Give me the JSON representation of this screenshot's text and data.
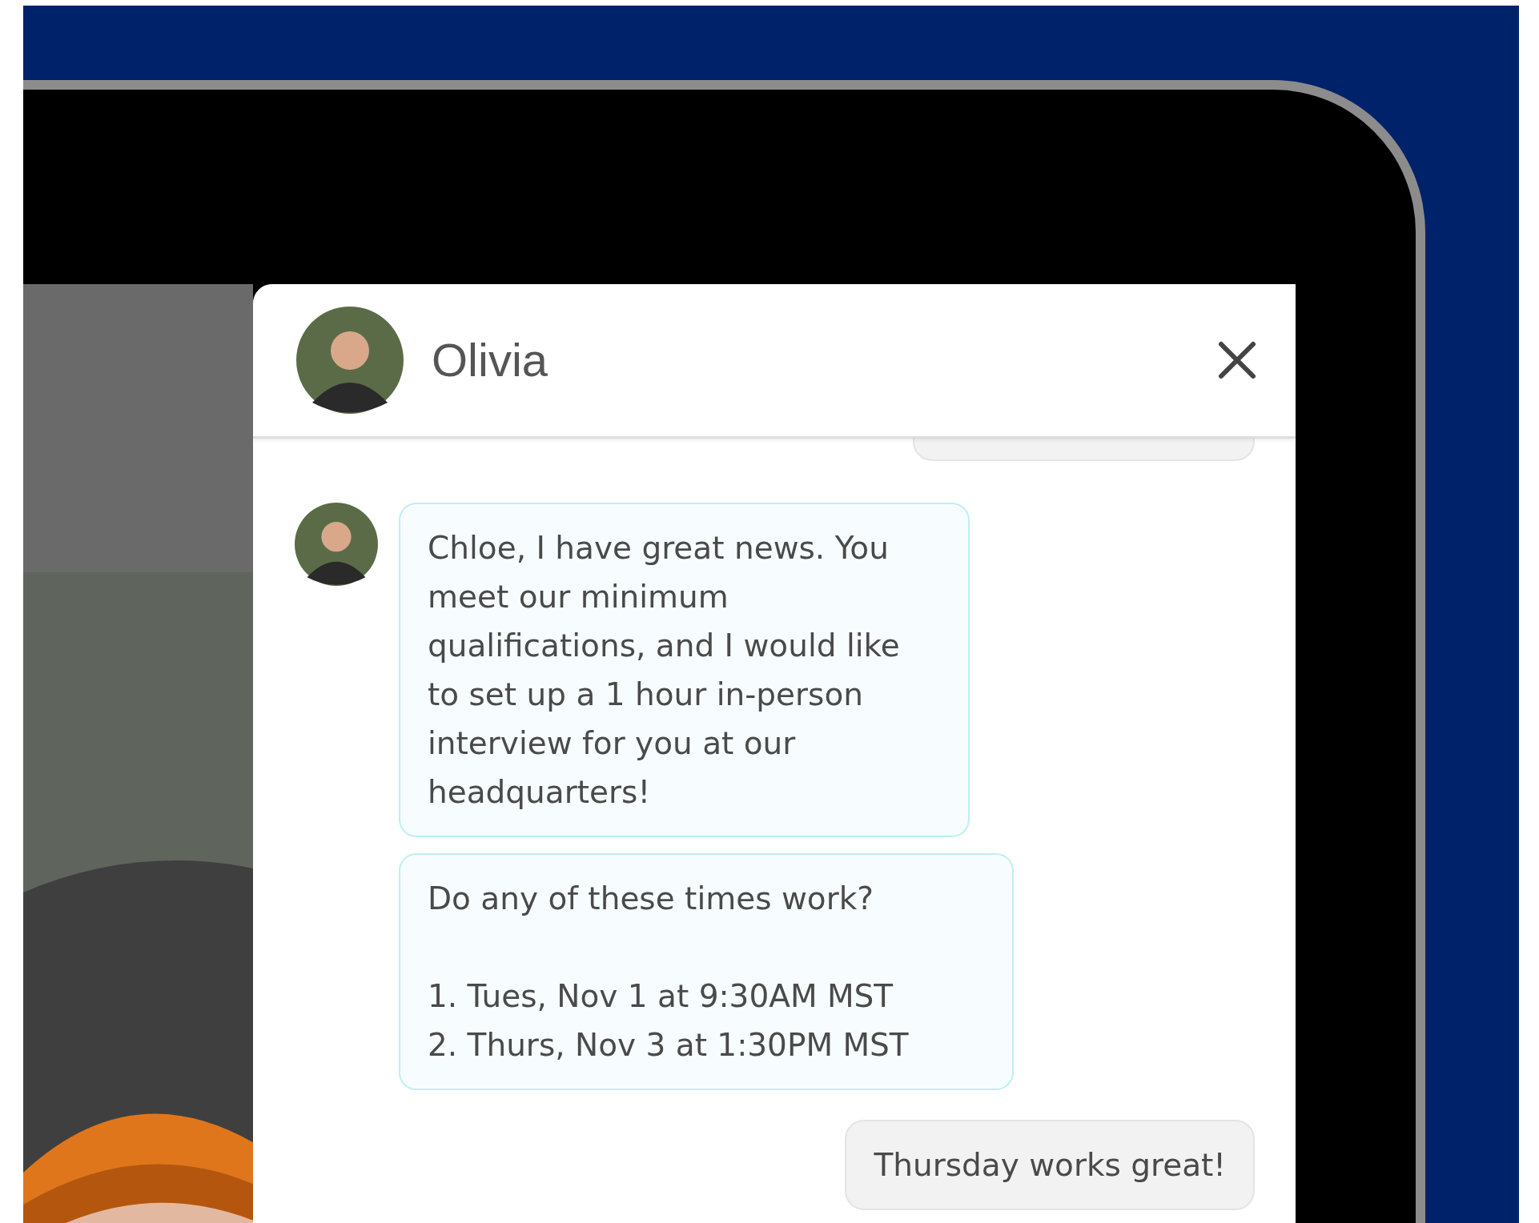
{
  "chat": {
    "contact_name": "Olivia",
    "messages": [
      {
        "kind": "contact",
        "text": "Chloe, I have great news. You meet our minimum qualifications, and I would like to set up a 1 hour in-person interview for you at our headquarters!"
      },
      {
        "kind": "contact",
        "text": "Do any of these times work?\n\n1. Tues, Nov 1 at 9:30AM MST\n2. Thurs, Nov 3 at 1:30PM MST"
      },
      {
        "kind": "user",
        "text": "Thursday works great!"
      }
    ]
  }
}
